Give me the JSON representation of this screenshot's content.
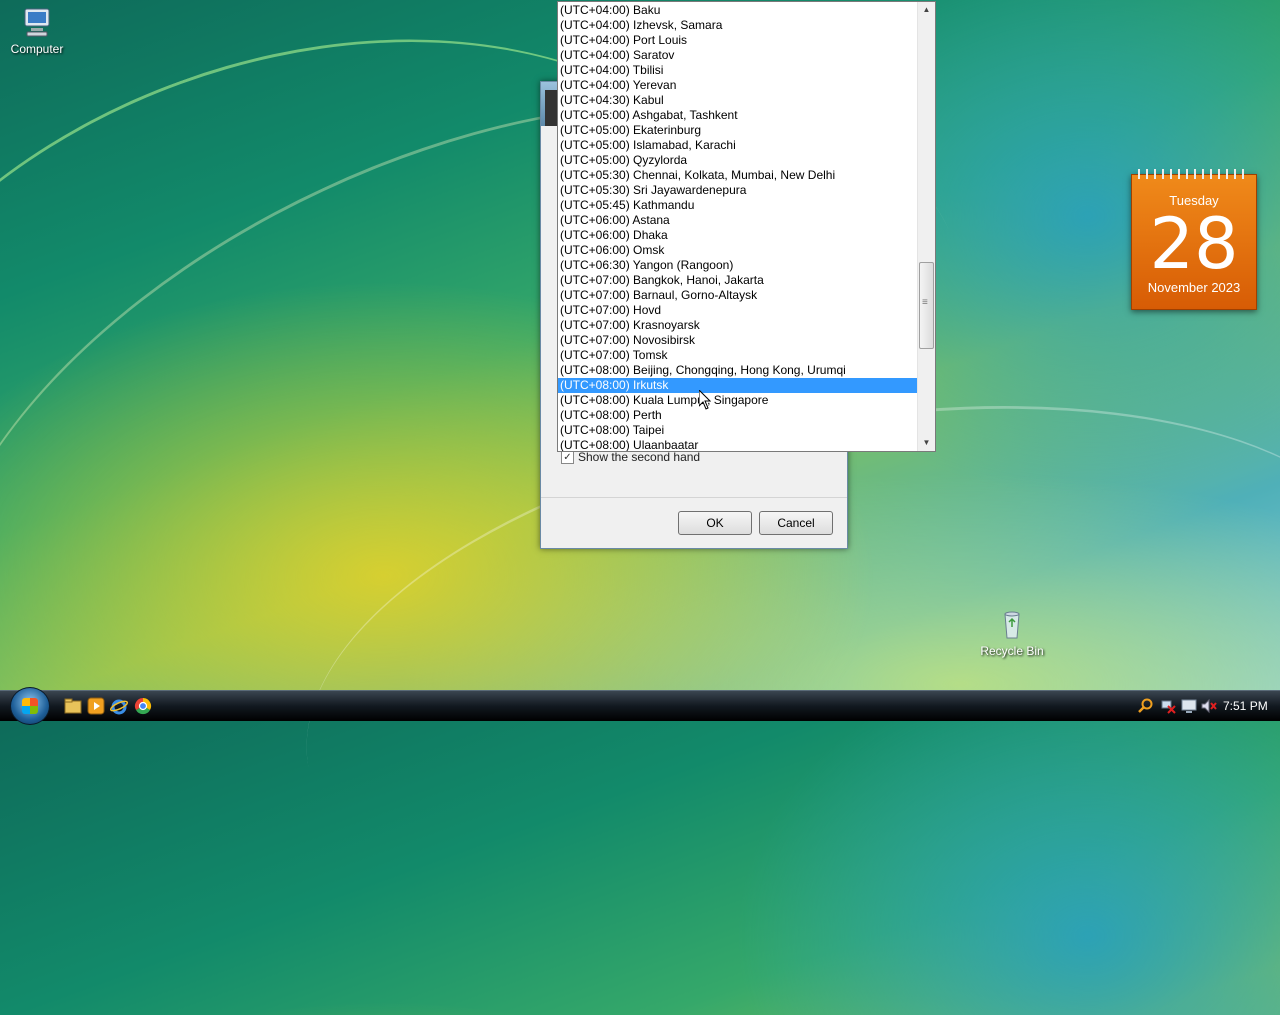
{
  "desktop": {
    "icons": [
      {
        "label": "Computer",
        "icon": "computer-icon"
      },
      {
        "label": "Recycle Bin",
        "icon": "recycle-bin-icon"
      }
    ]
  },
  "calendar": {
    "weekday": "Tuesday",
    "day": "28",
    "month_year": "November 2023"
  },
  "dialog": {
    "checkbox_label": "Show the second hand",
    "checkbox_checked": true,
    "ok_label": "OK",
    "cancel_label": "Cancel"
  },
  "timezone_list": {
    "selected": "(UTC+08:00) Irkutsk",
    "items": [
      "(UTC+04:00) Baku",
      "(UTC+04:00) Izhevsk, Samara",
      "(UTC+04:00) Port Louis",
      "(UTC+04:00) Saratov",
      "(UTC+04:00) Tbilisi",
      "(UTC+04:00) Yerevan",
      "(UTC+04:30) Kabul",
      "(UTC+05:00) Ashgabat, Tashkent",
      "(UTC+05:00) Ekaterinburg",
      "(UTC+05:00) Islamabad, Karachi",
      "(UTC+05:00) Qyzylorda",
      "(UTC+05:30) Chennai, Kolkata, Mumbai, New Delhi",
      "(UTC+05:30) Sri Jayawardenepura",
      "(UTC+05:45) Kathmandu",
      "(UTC+06:00) Astana",
      "(UTC+06:00) Dhaka",
      "(UTC+06:00) Omsk",
      "(UTC+06:30) Yangon (Rangoon)",
      "(UTC+07:00) Bangkok, Hanoi, Jakarta",
      "(UTC+07:00) Barnaul, Gorno-Altaysk",
      "(UTC+07:00) Hovd",
      "(UTC+07:00) Krasnoyarsk",
      "(UTC+07:00) Novosibirsk",
      "(UTC+07:00) Tomsk",
      "(UTC+08:00) Beijing, Chongqing, Hong Kong, Urumqi",
      "(UTC+08:00) Irkutsk",
      "(UTC+08:00) Kuala Lumpur, Singapore",
      "(UTC+08:00) Perth",
      "(UTC+08:00) Taipei",
      "(UTC+08:00) Ulaanbaatar"
    ]
  },
  "taskbar": {
    "quick_launch": [
      "explorer-icon",
      "media-player-icon",
      "internet-explorer-icon",
      "chrome-icon"
    ],
    "tray": [
      "search-icon",
      "network-error-icon",
      "display-icon",
      "volume-muted-icon"
    ],
    "clock": "7:51 PM"
  }
}
